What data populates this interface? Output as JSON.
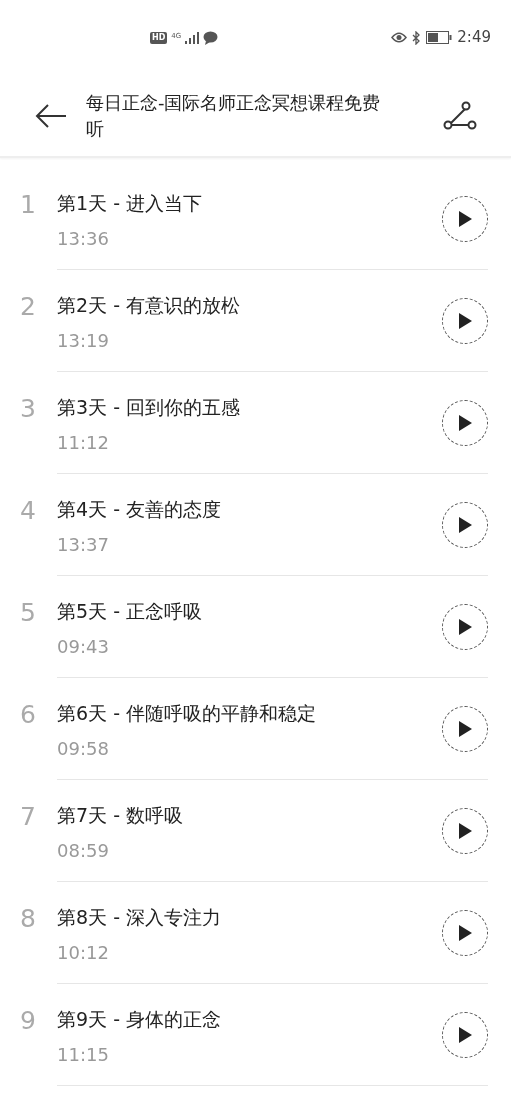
{
  "status_bar": {
    "hd": "HD",
    "network": "4G",
    "time": "2:49"
  },
  "header": {
    "title": "每日正念-国际名师正念冥想课程免费听"
  },
  "episodes": [
    {
      "number": "1",
      "title": "第1天 - 进入当下",
      "duration": "13:36"
    },
    {
      "number": "2",
      "title": "第2天 - 有意识的放松",
      "duration": "13:19"
    },
    {
      "number": "3",
      "title": "第3天 - 回到你的五感",
      "duration": "11:12"
    },
    {
      "number": "4",
      "title": "第4天 - 友善的态度",
      "duration": "13:37"
    },
    {
      "number": "5",
      "title": "第5天 - 正念呼吸",
      "duration": "09:43"
    },
    {
      "number": "6",
      "title": "第6天 - 伴随呼吸的平静和稳定",
      "duration": "09:58"
    },
    {
      "number": "7",
      "title": "第7天 - 数呼吸",
      "duration": "08:59"
    },
    {
      "number": "8",
      "title": "第8天 - 深入专注力",
      "duration": "10:12"
    },
    {
      "number": "9",
      "title": "第9天 - 身体的正念",
      "duration": "11:15"
    }
  ]
}
